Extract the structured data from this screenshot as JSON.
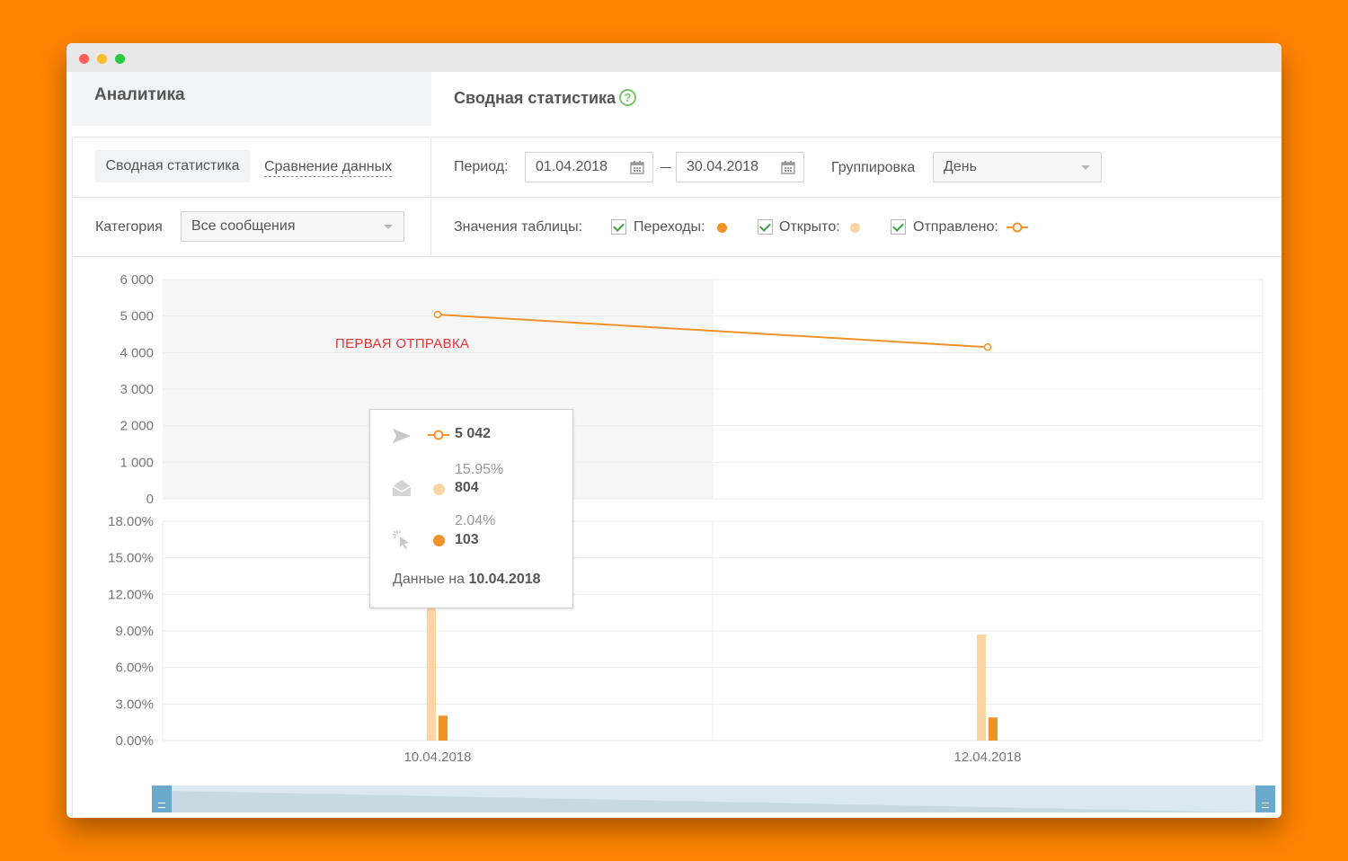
{
  "sidebar": {
    "title": "Аналитика"
  },
  "header": {
    "title": "Сводная статистика",
    "help_icon": "?"
  },
  "tabs": [
    {
      "label": "Сводная статистика",
      "active": true
    },
    {
      "label": "Сравнение данных",
      "active": false
    }
  ],
  "filters": {
    "period_label": "Период:",
    "date_from": "01.04.2018",
    "date_to": "30.04.2018",
    "grouping_label": "Группировка",
    "grouping_value": "День",
    "category_label": "Категория",
    "category_value": "Все сообщения",
    "table_values_label": "Значения таблицы:",
    "toggles": [
      {
        "label": "Переходы:",
        "checked": true,
        "color": "#f0922a"
      },
      {
        "label": "Открыто:",
        "checked": true,
        "color": "#fcd5a5"
      },
      {
        "label": "Отправлено:",
        "checked": true,
        "color": "#f0922a"
      }
    ]
  },
  "chart_data": [
    {
      "type": "line",
      "x": [
        "10.04.2018",
        "12.04.2018"
      ],
      "series": [
        {
          "name": "Отправлено",
          "values": [
            5042,
            4150
          ]
        }
      ],
      "ylim": [
        0,
        6000
      ],
      "yticks": [
        "6 000",
        "5 000",
        "4 000",
        "3 000",
        "2 000",
        "1 000",
        "0"
      ],
      "annotation": "ПЕРВАЯ ОТПРАВКА",
      "color": "#f0922a"
    },
    {
      "type": "bar",
      "categories": [
        "10.04.2018",
        "12.04.2018"
      ],
      "series": [
        {
          "name": "Открыто",
          "values": [
            15.95,
            8.7
          ],
          "color": "#fcd5a5"
        },
        {
          "name": "Переходы",
          "values": [
            2.04,
            1.9
          ],
          "color": "#f0922a"
        }
      ],
      "ylim": [
        0,
        18
      ],
      "yticks": [
        "18.00%",
        "15.00%",
        "12.00%",
        "9.00%",
        "6.00%",
        "3.00%",
        "0.00%"
      ],
      "xticks": [
        "10.04.2018",
        "12.04.2018"
      ]
    }
  ],
  "tooltip": {
    "sent": "5 042",
    "opened_pct": "15.95%",
    "opened": "804",
    "clicks_pct": "2.04%",
    "clicks": "103",
    "footer_prefix": "Данные на",
    "footer_date": "10.04.2018"
  }
}
